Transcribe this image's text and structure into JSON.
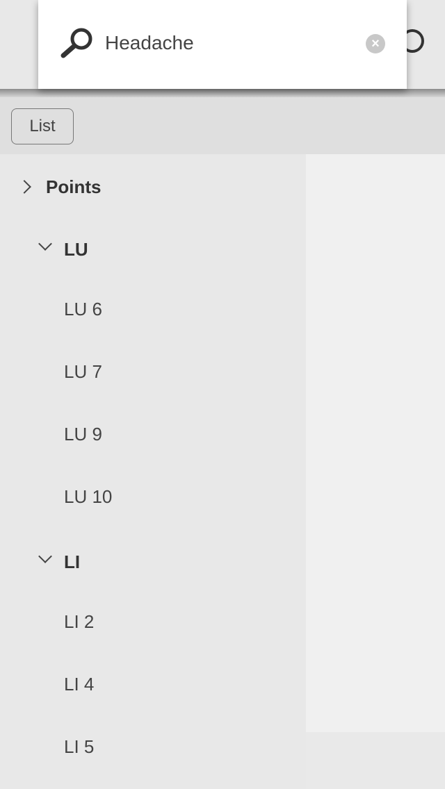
{
  "search": {
    "value": "Headache",
    "icon": "search-icon",
    "clear_icon": "clear-icon"
  },
  "toolbar": {
    "list_label": "List"
  },
  "tree": {
    "root": "Points",
    "groups": [
      {
        "label": "LU",
        "items": [
          "LU 6",
          "LU 7",
          "LU 9",
          "LU 10"
        ]
      },
      {
        "label": "LI",
        "items": [
          "LI 2",
          "LI 4",
          "LI 5"
        ]
      }
    ]
  }
}
